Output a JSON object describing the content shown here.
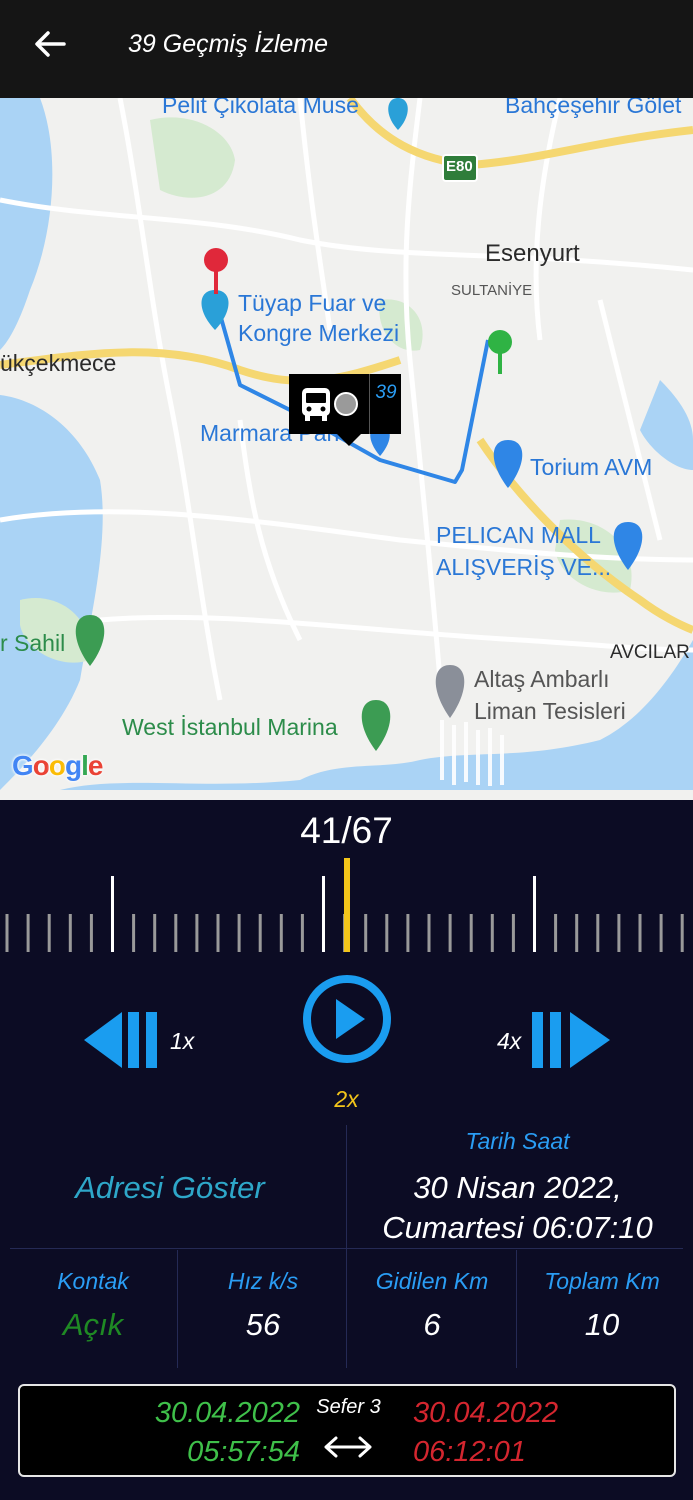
{
  "app_bar": {
    "title": "39 Geçmiş İzleme",
    "back_icon": "arrow-back-icon"
  },
  "map": {
    "labels": {
      "pelit": "Pelit Çikolata Muse",
      "bahcesehir": "Bahçeşehir Gölet",
      "e80": "E80",
      "esenyurt": "Esenyurt",
      "sultaniye": "SULTANİYE",
      "tuyap": "Tüyap Fuar ve",
      "tuyap2": "Kongre Merkezi",
      "kucukcekmece": "ükçekmece",
      "marmara": "Marmara Park",
      "torium": "Torium AVM",
      "pelican": "PELICAN MALL",
      "pelican2": "ALIŞVERİŞ VE...",
      "sahil": "r Sahil",
      "avcilar": "AVCILAR",
      "altas": "Altaş Ambarlı",
      "altas2": "Liman Tesisleri",
      "marina": "West İstanbul Marina",
      "google": "Google"
    },
    "vehicle_number": "39",
    "colors": {
      "route": "#2f86e6",
      "start_pin": "#2fb344",
      "end_pin": "#e0283a",
      "water": "#aad3f5"
    }
  },
  "playback": {
    "counter": "41/67",
    "current_index": 41,
    "total": 67,
    "slower_speed": "1x",
    "faster_speed": "4x",
    "current_speed": "2x",
    "accent": "#f3c51a"
  },
  "info": {
    "address_button": "Adresi Göster",
    "datetime_label": "Tarih Saat",
    "datetime_line1": "30 Nisan 2022,",
    "datetime_line2": "Cumartesi 06:07:10",
    "stats": {
      "ignition": {
        "label": "Kontak",
        "value": "Açık"
      },
      "speed": {
        "label": "Hız k/s",
        "value": "56"
      },
      "trip_km": {
        "label": "Gidilen Km",
        "value": "6"
      },
      "total_km": {
        "label": "Toplam Km",
        "value": "10"
      }
    }
  },
  "trip": {
    "title": "Sefer 3",
    "start_date": "30.04.2022",
    "start_time": "05:57:54",
    "end_date": "30.04.2022",
    "end_time": "06:12:01"
  }
}
